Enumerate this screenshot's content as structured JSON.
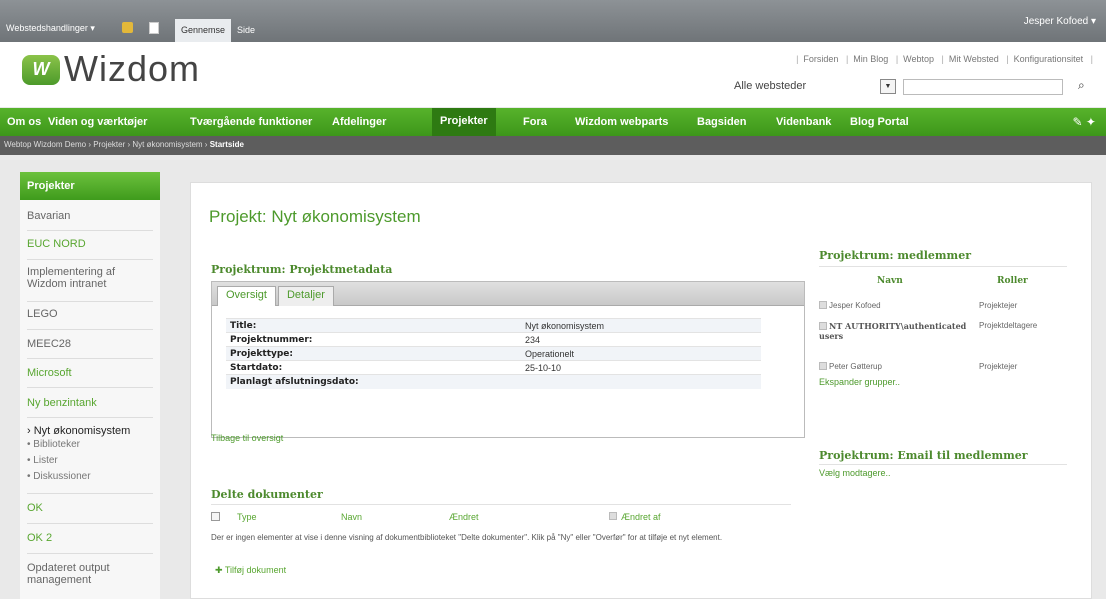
{
  "ribbon": {
    "site_actions": "Webstedshandlinger ▾",
    "tab_browse": "Gennemse",
    "tab_page": "Side",
    "user": "Jesper Kofoed ▾"
  },
  "header": {
    "logo_text": "Wizdom",
    "logo_mark": "W",
    "top_links": [
      "Forsiden",
      "Min Blog",
      "Webtop",
      "Mit Websted",
      "Konfigurationsitet"
    ],
    "search_scope": "Alle websteder",
    "search_placeholder": ""
  },
  "topnav": [
    "Om os",
    "Viden og værktøjer",
    "Tværgående funktioner",
    "Afdelinger",
    "Projekter",
    "Fora",
    "Wizdom webparts",
    "Bagsiden",
    "Videnbank",
    "Blog Portal"
  ],
  "breadcrumb": {
    "parts": [
      "Webtop Wizdom Demo",
      "Projekter",
      "Nyt økonomisystem"
    ],
    "current": "Startside"
  },
  "leftnav": {
    "header": "Projekter",
    "items": [
      "Bavarian",
      "EUC NORD",
      "Implementering af Wizdom intranet",
      "LEGO",
      "MEEC28",
      "Microsoft",
      "Ny benzintank",
      "› Nyt økonomisystem",
      "• Biblioteker",
      "• Lister",
      "• Diskussioner",
      "OK",
      "OK 2",
      "Opdateret output management"
    ]
  },
  "main": {
    "title": "Projekt: Nyt økonomisystem",
    "metadata_title": "Projektrum: Projektmetadata",
    "tabs": [
      "Oversigt",
      "Detaljer"
    ],
    "metadata": [
      {
        "key": "Title:",
        "value": "Nyt økonomisystem"
      },
      {
        "key": "Projektnummer:",
        "value": "234"
      },
      {
        "key": "Projekttype:",
        "value": "Operationelt"
      },
      {
        "key": "Startdato:",
        "value": "25-10-10"
      },
      {
        "key": "Planlagt afslutningsdato:",
        "value": ""
      }
    ],
    "back_link": "Tilbage til oversigt",
    "docs_title": "Delte dokumenter",
    "docs_columns": [
      "Type",
      "Navn",
      "Ændret",
      "Ændret af"
    ],
    "docs_empty": "Der er ingen elementer at vise i denne visning af dokumentbiblioteket \"Delte dokumenter\". Klik på \"Ny\" eller \"Overfør\" for at tilføje et nyt element.",
    "add_doc": "Tilføj dokument"
  },
  "members": {
    "title": "Projektrum: medlemmer",
    "col_name": "Navn",
    "col_role": "Roller",
    "rows": [
      {
        "name": "Jesper Kofoed",
        "role": "Projektejer"
      },
      {
        "name": "NT AUTHORITY\\authenticated users",
        "role": "Projektdeltagere"
      },
      {
        "name": "Peter Gøtterup",
        "role": "Projektejer"
      }
    ],
    "expand": "Ekspander grupper..",
    "email_title": "Projektrum: Email til medlemmer",
    "email_link": "Vælg modtagere.."
  }
}
